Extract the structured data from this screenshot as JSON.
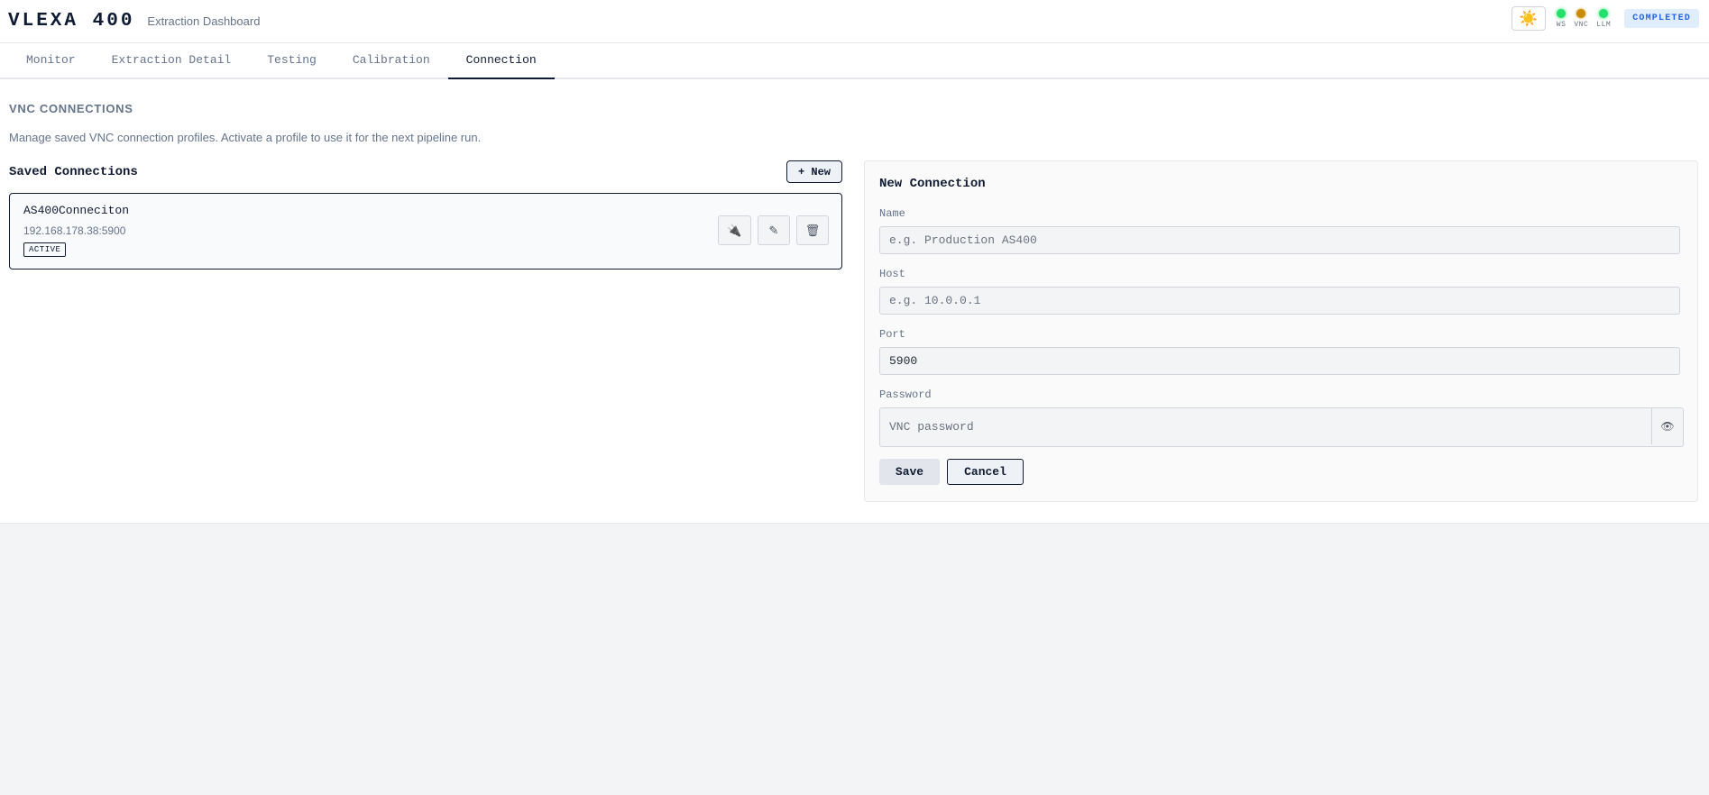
{
  "header": {
    "brand": "VLEXA 400",
    "subtitle": "Extraction Dashboard",
    "theme_icon": "☀️",
    "indicators": [
      {
        "label": "WS",
        "status": "ok",
        "color": "#22e06a"
      },
      {
        "label": "VNC",
        "status": "warn",
        "color": "#ca8a04"
      },
      {
        "label": "LLM",
        "status": "ok",
        "color": "#22e06a"
      }
    ],
    "status_badge": "COMPLETED"
  },
  "tabs": [
    {
      "label": "Monitor"
    },
    {
      "label": "Extraction Detail"
    },
    {
      "label": "Testing"
    },
    {
      "label": "Calibration"
    },
    {
      "label": "Connection",
      "active": true
    }
  ],
  "section": {
    "title": "VNC CONNECTIONS",
    "description": "Manage saved VNC connection profiles. Activate a profile to use it for the next pipeline run."
  },
  "saved": {
    "title": "Saved Connections",
    "new_label": "+ New",
    "items": [
      {
        "name": "AS400Conneciton",
        "host": "192.168.178.38:5900",
        "badge": "ACTIVE",
        "actions": [
          {
            "icon": "plug-icon",
            "glyph": "🔌"
          },
          {
            "icon": "edit-icon",
            "glyph": "✎"
          },
          {
            "icon": "trash-icon",
            "glyph": "🗑"
          }
        ]
      }
    ]
  },
  "form": {
    "title": "New Connection",
    "name": {
      "label": "Name",
      "value": "",
      "placeholder": "e.g. Production AS400"
    },
    "host": {
      "label": "Host",
      "value": "",
      "placeholder": "e.g. 10.0.0.1"
    },
    "port": {
      "label": "Port",
      "value": "5900",
      "placeholder": ""
    },
    "password": {
      "label": "Password",
      "value": "",
      "placeholder": "VNC password",
      "toggle_icon": "👁"
    },
    "save_label": "Save",
    "cancel_label": "Cancel"
  },
  "colors": {
    "accent": "#0f1b33",
    "muted": "#64748b",
    "completed_bg": "#e0eefc",
    "completed_fg": "#2563eb"
  }
}
